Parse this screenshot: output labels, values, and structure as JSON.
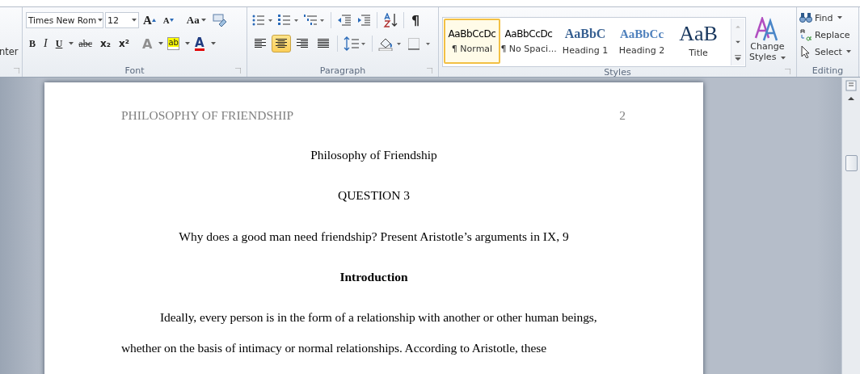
{
  "ribbon": {
    "clipped_group": {
      "label_fragment": "nter"
    },
    "font": {
      "label": "Font",
      "font_name": "Times New Rom",
      "font_size": "12",
      "row1": [
        {
          "kind": "grow",
          "text": "A"
        },
        {
          "kind": "shrink",
          "text": "A"
        },
        {
          "kind": "case",
          "text": "Aa"
        },
        {
          "kind": "clear"
        }
      ],
      "row2": [
        {
          "kind": "bold",
          "text": "B"
        },
        {
          "kind": "italic",
          "text": "I"
        },
        {
          "kind": "underline",
          "text": "U"
        },
        {
          "kind": "strike",
          "text": "abc"
        },
        {
          "kind": "sub",
          "text": "x₂"
        },
        {
          "kind": "sup",
          "text": "x²"
        },
        {
          "kind": "effects",
          "text": "A"
        },
        {
          "kind": "highlight",
          "text": "ab"
        },
        {
          "kind": "color",
          "text": "A"
        }
      ]
    },
    "paragraph": {
      "label": "Paragraph",
      "show_marks": "¶",
      "alignments": [
        {
          "kind": "left",
          "selected": false
        },
        {
          "kind": "center",
          "selected": true
        },
        {
          "kind": "right",
          "selected": false
        },
        {
          "kind": "justify",
          "selected": false
        }
      ]
    },
    "styles": {
      "label": "Styles",
      "items": [
        {
          "kind": "normal",
          "preview": "AaBbCcDc",
          "name": "¶ Normal",
          "selected": true
        },
        {
          "kind": "nospacing",
          "preview": "AaBbCcDc",
          "name": "¶ No Spaci...",
          "selected": false
        },
        {
          "kind": "heading1",
          "preview": "AaBbC",
          "name": "Heading 1",
          "selected": false
        },
        {
          "kind": "heading2",
          "preview": "AaBbCc",
          "name": "Heading 2",
          "selected": false
        },
        {
          "kind": "title",
          "preview": "AaB",
          "name": "Title",
          "selected": false
        }
      ],
      "change_styles": [
        "Change",
        "Styles"
      ]
    },
    "editing": {
      "label": "Editing",
      "commands": [
        {
          "kind": "find",
          "text": "Find",
          "dropdown": true
        },
        {
          "kind": "replace",
          "text": "Replace",
          "dropdown": false
        },
        {
          "kind": "select",
          "text": "Select",
          "dropdown": true
        }
      ]
    }
  },
  "document": {
    "header": "PHILOSOPHY OF FRIENDSHIP",
    "page_number": "2",
    "blocks": [
      {
        "kind": "center",
        "text": "Philosophy of Friendship"
      },
      {
        "kind": "center",
        "text": "QUESTION 3"
      },
      {
        "kind": "center",
        "text": "Why does a good man need friendship? Present Aristotle’s arguments in IX, 9"
      },
      {
        "kind": "heading",
        "text": "Introduction"
      },
      {
        "kind": "body",
        "lines": [
          "Ideally, every person is in the form of a relationship with another or other human beings,",
          "whether on the basis of intimacy or normal relationships.  According to Aristotle, these"
        ]
      }
    ]
  }
}
